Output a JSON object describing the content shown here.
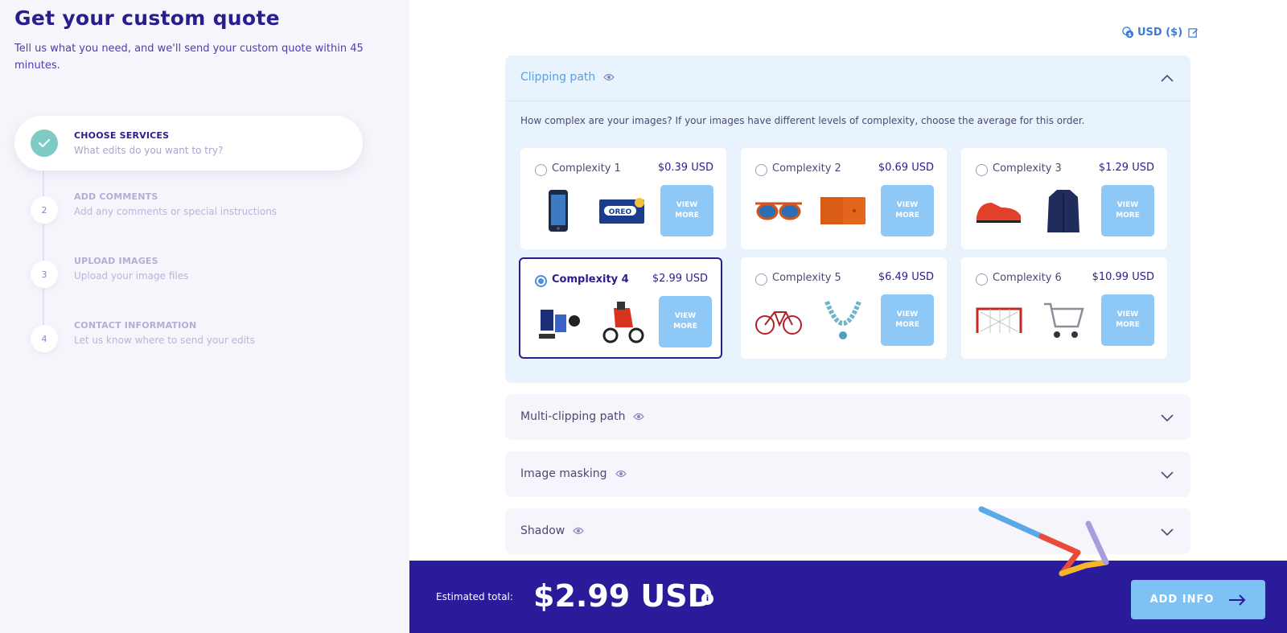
{
  "header": {
    "title": "Get your custom quote",
    "subtitle": "Tell us what you need, and we'll send your custom quote within 45 minutes."
  },
  "steps": [
    {
      "number": "",
      "title": "CHOOSE SERVICES",
      "desc": "What edits do you want to try?",
      "state": "active-complete"
    },
    {
      "number": "2",
      "title": "ADD COMMENTS",
      "desc": "Add any comments or special instructions",
      "state": "pending"
    },
    {
      "number": "3",
      "title": "UPLOAD IMAGES",
      "desc": "Upload your image files",
      "state": "pending"
    },
    {
      "number": "4",
      "title": "CONTACT INFORMATION",
      "desc": "Let us know where to send your edits",
      "state": "pending"
    }
  ],
  "currency": {
    "label": "USD ($)",
    "icon": "coin-icon",
    "edit_icon": "edit-icon"
  },
  "services": {
    "open": {
      "title": "Clipping path",
      "question": "How complex are your images? If your images have different levels of complexity, choose the average for this order.",
      "options": [
        {
          "name": "Complexity 1",
          "price": "$0.39 USD",
          "thumbs": [
            "smartphone",
            "cookie-box"
          ],
          "view_more": "VIEW MORE",
          "selected": false
        },
        {
          "name": "Complexity 2",
          "price": "$0.69 USD",
          "thumbs": [
            "sunglasses",
            "wallet"
          ],
          "view_more": "VIEW MORE",
          "selected": false
        },
        {
          "name": "Complexity 3",
          "price": "$1.29 USD",
          "thumbs": [
            "sneaker",
            "coat"
          ],
          "view_more": "VIEW MORE",
          "selected": false
        },
        {
          "name": "Complexity 4",
          "price": "$2.99 USD",
          "thumbs": [
            "sports-gear",
            "tricycle"
          ],
          "view_more": "VIEW MORE",
          "selected": true
        },
        {
          "name": "Complexity 5",
          "price": "$6.49 USD",
          "thumbs": [
            "bicycle",
            "necklace"
          ],
          "view_more": "VIEW MORE",
          "selected": false
        },
        {
          "name": "Complexity 6",
          "price": "$10.99 USD",
          "thumbs": [
            "hockey-net",
            "shopping-cart"
          ],
          "view_more": "VIEW MORE",
          "selected": false
        }
      ]
    },
    "collapsed": [
      {
        "title": "Multi-clipping path"
      },
      {
        "title": "Image masking"
      },
      {
        "title": "Shadow"
      }
    ]
  },
  "footer": {
    "estimated_label": "Estimated total:",
    "estimated_value": "$2.99 USD",
    "info_icon": "i",
    "add_button": "ADD INFO"
  },
  "colors": {
    "primary": "#2a1b9a",
    "accent": "#7ec2f5",
    "success": "#7ecbc3",
    "panel_open_bg": "#e8f3fe"
  }
}
